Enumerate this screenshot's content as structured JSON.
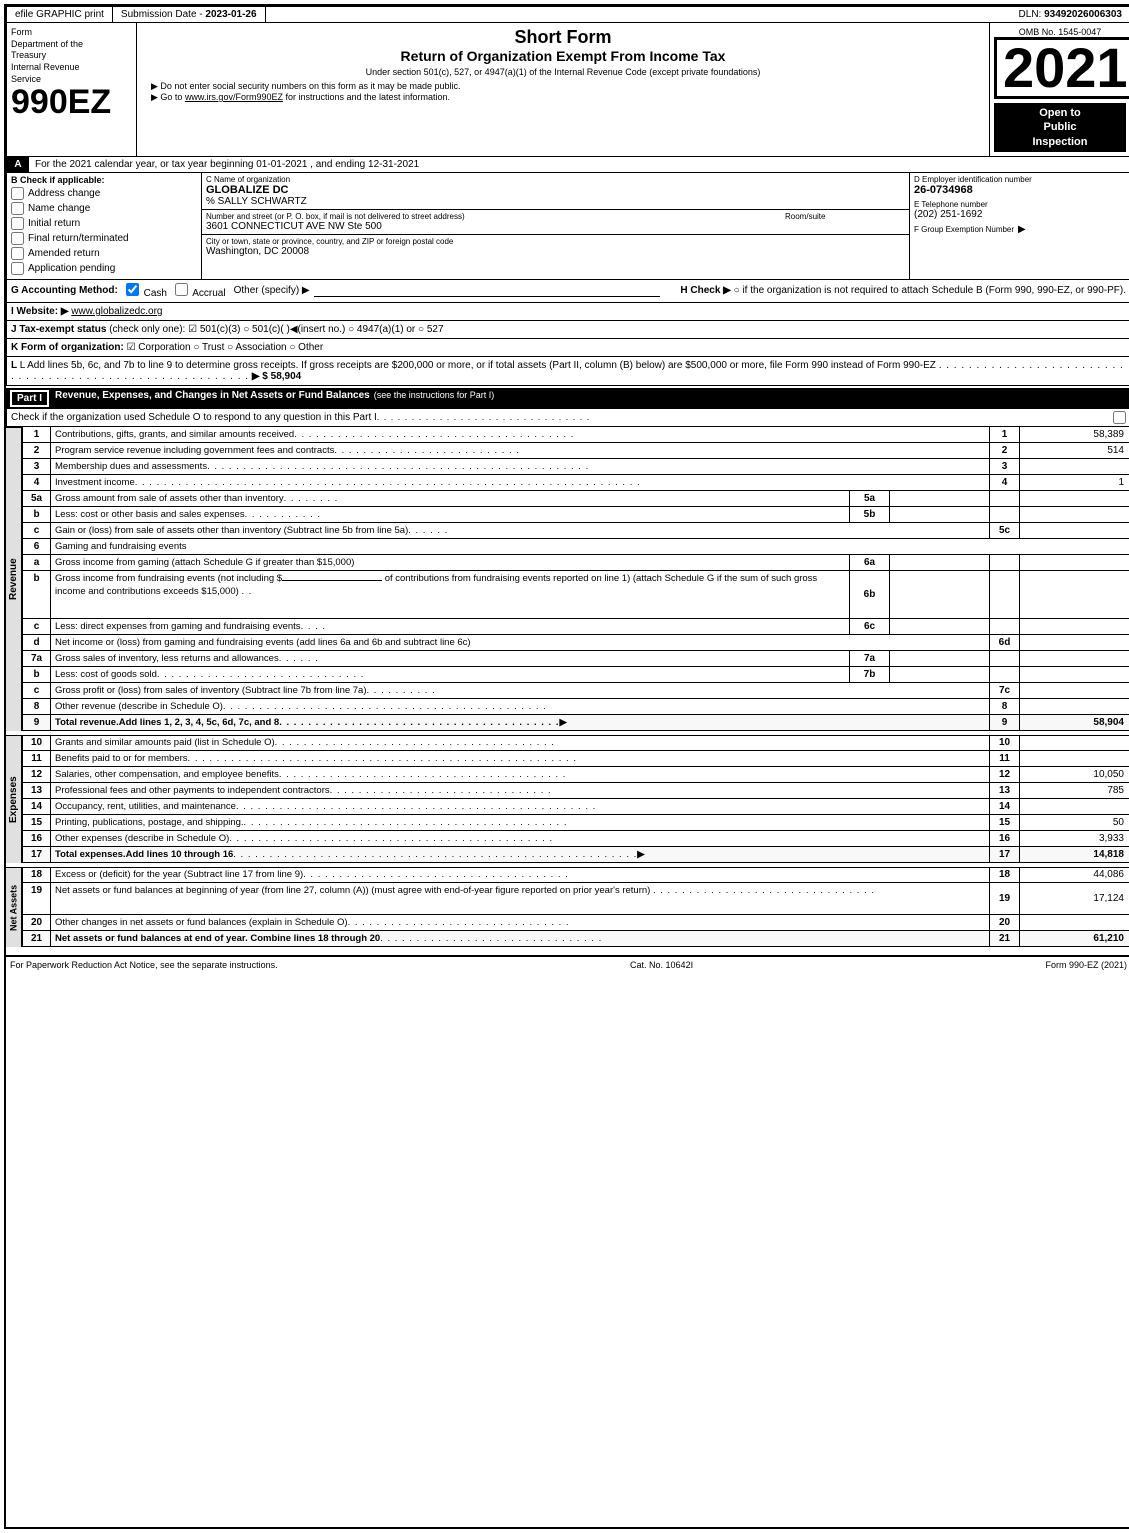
{
  "topBar": {
    "efile": "efile GRAPHIC print",
    "submissionLabel": "Submission Date -",
    "submissionDate": "2023-01-26",
    "dlnLabel": "DLN:",
    "dln": "93492026006303"
  },
  "header": {
    "formLabel": "Form",
    "formNumber": "990EZ",
    "dept1": "Department of the",
    "dept2": "Treasury",
    "dept3": "Internal Revenue",
    "dept4": "Service",
    "title1": "Short Form",
    "title2": "Return of Organization Exempt From Income Tax",
    "subtitle": "Under section 501(c), 527, or 4947(a)(1) of the Internal Revenue Code (except private foundations)",
    "instr1": "▶ Do not enter social security numbers on this form as it may be made public.",
    "instr2": "▶ Go to www.irs.gov/Form990EZ for instructions and the latest information.",
    "instr2_url": "www.irs.gov/Form990EZ",
    "year": "2021",
    "ombNo": "OMB No. 1545-0047",
    "openToPublic": "Open to Public Inspection"
  },
  "sectionA": {
    "label": "A",
    "text": "For the 2021 calendar year, or tax year beginning 01-01-2021 , and ending 12-31-2021"
  },
  "checkApplicable": {
    "label": "B Check if applicable:",
    "options": {
      "addressChange": "Address change",
      "nameChange": "Name change",
      "initialReturn": "Initial return",
      "finalReturn": "Final return/terminated",
      "amendedReturn": "Amended return",
      "applicationPending": "Application pending"
    }
  },
  "orgInfo": {
    "cLabel": "C Name of organization",
    "orgName": "GLOBALIZE DC",
    "careOf": "% SALLY SCHWARTZ",
    "streetLabel": "Number and street (or P. O. box, if mail is not delivered to street address)",
    "street": "3601 CONNECTICUT AVE NW Ste 500",
    "roomLabel": "Room/suite",
    "room": "",
    "cityLabel": "City or town, state or province, country, and ZIP or foreign postal code",
    "city": "Washington, DC  20008"
  },
  "employerId": {
    "dLabel": "D Employer identification number",
    "ein": "26-0734968",
    "eLabel": "E Telephone number",
    "phone": "(202) 251-1692",
    "fLabel": "F Group Exemption Number",
    "fSymbol": "▶"
  },
  "accounting": {
    "gLabel": "G Accounting Method:",
    "cashLabel": "Cash",
    "accrualLabel": "Accrual",
    "otherLabel": "Other (specify) ▶",
    "hLabel": "H  Check ▶",
    "hText": "○ if the organization is not required to attach Schedule B (Form 990, 990-EZ, or 990-PF)."
  },
  "website": {
    "label": "I Website: ▶",
    "url": "www.globalizedc.org"
  },
  "taxExempt": {
    "label": "J Tax-exempt status",
    "checkOnly": "(check only one):",
    "options": "☑ 501(c)(3)  ○ 501(c)(   )◀(insert no.)  ○ 4947(a)(1) or  ○ 527"
  },
  "formOrg": {
    "label": "K Form of organization:",
    "options": "☑ Corporation  ○ Trust  ○ Association  ○ Other"
  },
  "lLine": {
    "text": "L Add lines 5b, 6c, and 7b to line 9 to determine gross receipts. If gross receipts are $200,000 or more, or if total assets (Part II, column (B) below) are $500,000 or more, file Form 990 instead of Form 990-EZ",
    "dots": ". . . . . . . . . . . . . . . . . . . . . . . . . . . . . . . . . . . . . . . . . . . . . . . . . . . . . . . . .",
    "arrow": "▶ $",
    "value": "58,904"
  },
  "partI": {
    "label": "Part I",
    "title": "Revenue, Expenses, and Changes in Net Assets or Fund Balances",
    "seeInstr": "(see the instructions for Part I)",
    "checkScheduleO": "Check if the organization used Schedule O to respond to any question in this Part I",
    "dots": ". . . . . . . . . . . . . . . . . . . . . . . . . . . . . . .",
    "checkBox": "□"
  },
  "revenueRows": [
    {
      "num": "1",
      "label": "Contributions, gifts, grants, and similar amounts received",
      "dots": ". . . . . . . . . . . . . . . . . . . . . . . . . . . . . . . . . . . . . . .",
      "colNum": "1",
      "value": "58,389"
    },
    {
      "num": "2",
      "label": "Program service revenue including government fees and contracts",
      "dots": ". . . . . . . . . . . . . . . . . . . . . . . . . .",
      "colNum": "2",
      "value": "514"
    },
    {
      "num": "3",
      "label": "Membership dues and assessments",
      "dots": ". . . . . . . . . . . . . . . . . . . . . . . . . . . . . . . . . . . . . . . . . . . . . . . . . . . . .",
      "colNum": "3",
      "value": ""
    },
    {
      "num": "4",
      "label": "Investment income",
      "dots": ". . . . . . . . . . . . . . . . . . . . . . . . . . . . . . . . . . . . . . . . . . . . . . . . . . . . . . . . . . . . . . . . . . . . . . .",
      "colNum": "4",
      "value": "1"
    },
    {
      "num": "5a",
      "label": "Gross amount from sale of assets other than inventory",
      "dots": ". . . . . . . .",
      "subCol": "5a",
      "colNum": "",
      "value": ""
    },
    {
      "num": "5b",
      "label": "Less: cost or other basis and sales expenses",
      "dots": ". . . . . . . . . . .",
      "subCol": "5b",
      "colNum": "",
      "value": ""
    },
    {
      "num": "5c",
      "label": "Gain or (loss) from sale of assets other than inventory (Subtract line 5b from line 5a)",
      "dots": ". . . . . .",
      "colNum": "5c",
      "value": ""
    },
    {
      "num": "6",
      "label": "Gaming and fundraising events",
      "dots": "",
      "colNum": "",
      "value": ""
    },
    {
      "num": "6a",
      "label": "Gross income from gaming (attach Schedule G if greater than $15,000)",
      "dots": "",
      "subCol": "6a",
      "colNum": "",
      "value": ""
    },
    {
      "num": "6b",
      "label": "Gross income from fundraising events (not including $_______________of contributions from fundraising events reported on line 1) (attach Schedule G if the sum of such gross income and contributions exceeds $15,000)",
      "dots": "",
      "subCol": "6b",
      "colNum": "",
      "value": "",
      "multiline": true
    },
    {
      "num": "6c",
      "label": "Less: direct expenses from gaming and fundraising events",
      "dots": ". . . .",
      "subCol": "6c",
      "colNum": "",
      "value": ""
    },
    {
      "num": "6d",
      "label": "Net income or (loss) from gaming and fundraising events (add lines 6a and 6b and subtract line 6c)",
      "dots": "",
      "colNum": "6d",
      "value": ""
    },
    {
      "num": "7a",
      "label": "Gross sales of inventory, less returns and allowances",
      "dots": ". . . . . .",
      "subCol": "7a",
      "colNum": "",
      "value": ""
    },
    {
      "num": "7b",
      "label": "Less: cost of goods sold",
      "dots": ". . . . . . . . . . . . . . . . . . . . . . . . . . . . .",
      "subCol": "7b",
      "colNum": "",
      "value": ""
    },
    {
      "num": "7c",
      "label": "Gross profit or (loss) from sales of inventory (Subtract line 7b from line 7a)",
      "dots": ". . . . . . . . . .",
      "colNum": "7c",
      "value": ""
    },
    {
      "num": "8",
      "label": "Other revenue (describe in Schedule O)",
      "dots": ". . . . . . . . . . . . . . . . . . . . . . . . . . . . . . . . . . . . . . . . . . . . .",
      "colNum": "8",
      "value": ""
    },
    {
      "num": "9",
      "label": "Total revenue. Add lines 1, 2, 3, 4, 5c, 6d, 7c, and 8",
      "dots": ". . . . . . . . . . . . . . . . . . . . . . . . . . . . . . . . . . . . . . .",
      "arrow": "▶",
      "colNum": "9",
      "value": "58,904",
      "bold": true
    }
  ],
  "expenseRows": [
    {
      "num": "10",
      "label": "Grants and similar amounts paid (list in Schedule O)",
      "dots": ". . . . . . . . . . . . . . . . . . . . . . . . . . . . . . . . . . . . . .",
      "colNum": "10",
      "value": ""
    },
    {
      "num": "11",
      "label": "Benefits paid to or for members",
      "dots": ". . . . . . . . . . . . . . . . . . . . . . . . . . . . . . . . . . . . . . . . . . . . . . . . . . . . . .",
      "colNum": "11",
      "value": ""
    },
    {
      "num": "12",
      "label": "Salaries, other compensation, and employee benefits",
      "dots": ". . . . . . . . . . . . . . . . . . . . . . . . . . . . . . . . . . . . . . . .",
      "colNum": "12",
      "value": "10,050"
    },
    {
      "num": "13",
      "label": "Professional fees and other payments to independent contractors",
      "dots": ". . . . . . . . . . . . . . . . . . . . . . . . . . . . . . .",
      "colNum": "13",
      "value": "785"
    },
    {
      "num": "14",
      "label": "Occupancy, rent, utilities, and maintenance",
      "dots": ". . . . . . . . . . . . . . . . . . . . . . . . . . . . . . . . . . . . . . . . . . . . . . . . . .",
      "colNum": "14",
      "value": ""
    },
    {
      "num": "15",
      "label": "Printing, publications, postage, and shipping.",
      "dots": ". . . . . . . . . . . . . . . . . . . . . . . . . . . . . . . . . . . . . . . . . . . . . .",
      "colNum": "15",
      "value": "50"
    },
    {
      "num": "16",
      "label": "Other expenses (describe in Schedule O)",
      "dots": ". . . . . . . . . . . . . . . . . . . . . . . . . . . . . . . . . . . . . . . . . . . . .",
      "colNum": "16",
      "value": "3,933"
    },
    {
      "num": "17",
      "label": "Total expenses. Add lines 10 through 16",
      "dots": ". . . . . . . . . . . . . . . . . . . . . . . . . . . . . . . . . . . . . . . . . . . . . . . . . . . . . . . .",
      "arrow": "▶",
      "colNum": "17",
      "value": "14,818",
      "bold": true
    }
  ],
  "netAssetsRows": [
    {
      "num": "18",
      "label": "Excess or (deficit) for the year (Subtract line 17 from line 9)",
      "dots": ". . . . . . . . . . . . . . . . . . . . . . . . . . . . . . . . . . . . .",
      "colNum": "18",
      "value": "44,086"
    },
    {
      "num": "19",
      "label": "Net assets or fund balances at beginning of year (from line 27, column (A)) (must agree with end-of-year figure reported on prior year's return)",
      "dots": ". . . . . . . . . . . . . . . . . . . . . . . . . . . . . . .",
      "colNum": "19",
      "value": "17,124",
      "multiline": true
    },
    {
      "num": "20",
      "label": "Other changes in net assets or fund balances (explain in Schedule O)",
      "dots": ". . . . . . . . . . . . . . . . . . . . . . . . . . . . . . .",
      "colNum": "20",
      "value": ""
    },
    {
      "num": "21",
      "label": "Net assets or fund balances at end of year. Combine lines 18 through 20",
      "dots": ". . . . . . . . . . . . . . . . . . . . . . . . . . . . . . .",
      "colNum": "21",
      "value": "61,210",
      "bold": true
    }
  ],
  "footer": {
    "paperwork": "For Paperwork Reduction Act Notice, see the separate instructions.",
    "cat": "Cat. No. 10642I",
    "form": "Form 990-EZ (2021)"
  }
}
